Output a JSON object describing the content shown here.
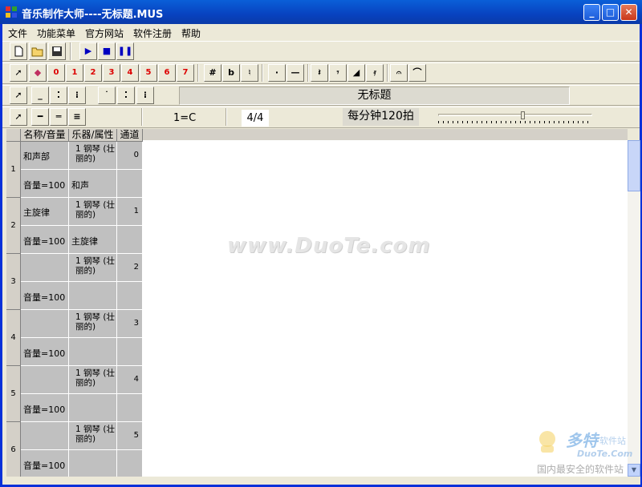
{
  "window": {
    "title": "音乐制作大师----无标题.MUS",
    "minimize": "_",
    "maximize": "□",
    "close": "✕"
  },
  "menu": [
    "文件",
    "功能菜单",
    "官方网站",
    "软件注册",
    "帮助"
  ],
  "toolbar1": {
    "buttons": [
      "new-file-icon",
      "open-folder-icon",
      "save-icon",
      "play-icon",
      "stop-icon",
      "pause-icon"
    ]
  },
  "toolbar2": {
    "notes": [
      "0",
      "1",
      "2",
      "3",
      "4",
      "5",
      "6",
      "7"
    ],
    "accidentals": [
      "#",
      "b",
      "♮"
    ],
    "marks": [
      "·",
      "—"
    ]
  },
  "toolbar3": {
    "song_title": "无标题"
  },
  "toolbar4": {
    "key": "1=C",
    "time_signature": "4/4",
    "tempo": "每分钟120拍",
    "tempo_level": 0.55
  },
  "grid": {
    "headers": [
      "名称/音量",
      "乐器/属性",
      "通道"
    ],
    "tracks": [
      {
        "num": "1",
        "name": "和声部",
        "volume": "音量=100",
        "instrument": "1 钢琴 (壮丽的)",
        "attr": "和声",
        "channel": "0"
      },
      {
        "num": "2",
        "name": "主旋律",
        "volume": "音量=100",
        "instrument": "1 钢琴 (壮丽的)",
        "attr": "主旋律",
        "channel": "1"
      },
      {
        "num": "3",
        "name": "",
        "volume": "音量=100",
        "instrument": "1 钢琴 (壮丽的)",
        "attr": "",
        "channel": "2"
      },
      {
        "num": "4",
        "name": "",
        "volume": "音量=100",
        "instrument": "1 钢琴 (壮丽的)",
        "attr": "",
        "channel": "3"
      },
      {
        "num": "5",
        "name": "",
        "volume": "音量=100",
        "instrument": "1 钢琴 (壮丽的)",
        "attr": "",
        "channel": "4"
      },
      {
        "num": "6",
        "name": "",
        "volume": "音量=100",
        "instrument": "1 钢琴 (壮丽的)",
        "attr": "",
        "channel": "5"
      }
    ]
  },
  "watermark": "www.DuoTe.com",
  "brand": {
    "name": "多特",
    "tag": "软件站",
    "url": "DuoTe.Com",
    "slogan": "国内最安全的软件站"
  }
}
